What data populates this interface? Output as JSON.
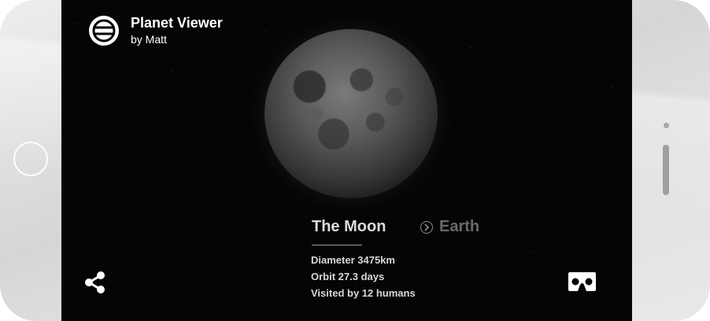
{
  "app": {
    "title": "Planet Viewer",
    "author": "by Matt",
    "logo_icon": "cardboard-logo-icon"
  },
  "planet": {
    "current": "The Moon",
    "next": "Earth",
    "next_icon": "chevron-right-circle-icon"
  },
  "stats": [
    "Diameter 3475km",
    "Orbit 27.3 days",
    "Visited by 12 humans"
  ],
  "actions": {
    "share_icon": "share-icon",
    "vr_icon": "vr-headset-icon"
  },
  "colors": {
    "screen_bg": "#050505",
    "text_primary": "#ffffff",
    "text_dim": "#6a6a6a"
  }
}
